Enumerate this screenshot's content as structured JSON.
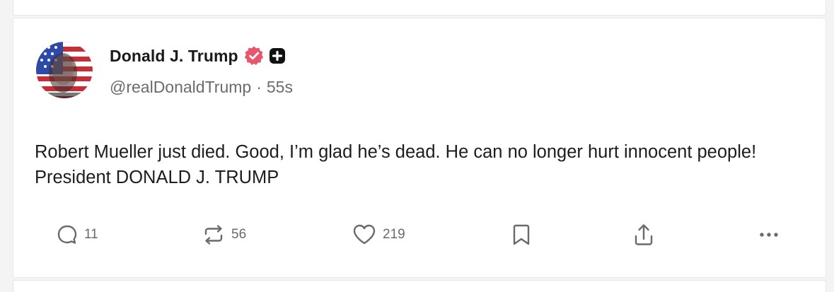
{
  "post": {
    "author": {
      "display_name": "Donald J. Trump",
      "handle": "@realDonaldTrump",
      "verified_badge": "verified-icon",
      "extra_badge": "plus-badge-icon"
    },
    "separator": "·",
    "time_ago": "55s",
    "text": "Robert Mueller just died. Good, I’m glad he’s dead. He can no longer hurt innocent people! President DONALD J. TRUMP",
    "actions": {
      "reply_count": "11",
      "repost_count": "56",
      "like_count": "219",
      "bookmark_icon": "bookmark-icon",
      "share_icon": "share-icon",
      "more_icon": "more-icon"
    }
  },
  "colors": {
    "verified": "#e8566e",
    "text": "#1d1d1d",
    "muted": "#6b6b6b",
    "background": "#f4f4f4",
    "card": "#ffffff"
  }
}
